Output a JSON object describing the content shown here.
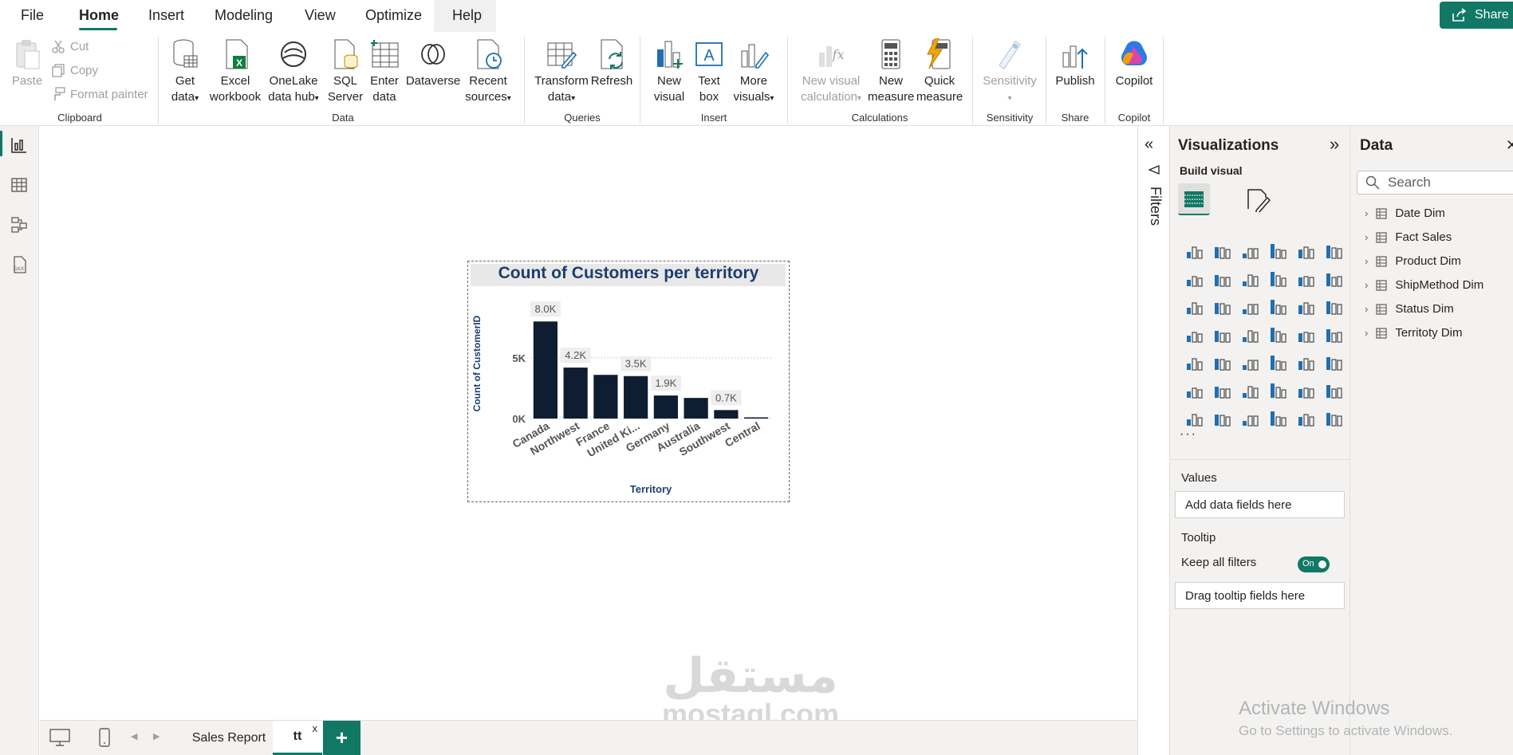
{
  "menu": {
    "items": [
      "File",
      "Home",
      "Insert",
      "Modeling",
      "View",
      "Optimize",
      "Help"
    ],
    "share_label": "Share"
  },
  "ribbon": {
    "clipboard": {
      "paste": "Paste",
      "cut": "Cut",
      "copy": "Copy",
      "format_painter": "Format painter",
      "group": "Clipboard"
    },
    "data": {
      "get_data": [
        "Get",
        "data"
      ],
      "excel": [
        "Excel",
        "workbook"
      ],
      "onelake": [
        "OneLake",
        "data hub"
      ],
      "sql": [
        "SQL",
        "Server"
      ],
      "enter": [
        "Enter",
        "data"
      ],
      "dataverse": "Dataverse",
      "recent": [
        "Recent",
        "sources"
      ],
      "group": "Data"
    },
    "queries": {
      "transform": [
        "Transform",
        "data"
      ],
      "refresh": "Refresh",
      "group": "Queries"
    },
    "insert": {
      "new_visual": [
        "New",
        "visual"
      ],
      "text_box": [
        "Text",
        "box"
      ],
      "more_visuals": [
        "More",
        "visuals"
      ],
      "group": "Insert"
    },
    "calculations": {
      "new_visual_calc": [
        "New visual",
        "calculation"
      ],
      "new_measure": [
        "New",
        "measure"
      ],
      "quick_measure": [
        "Quick",
        "measure"
      ],
      "group": "Calculations"
    },
    "sensitivity": {
      "label": "Sensitivity",
      "group": "Sensitivity"
    },
    "share": {
      "publish": "Publish",
      "group": "Share"
    },
    "copilot": {
      "label": "Copilot",
      "group": "Copilot"
    }
  },
  "visual": {
    "title": "Count of Customers per territory"
  },
  "chart_data": {
    "type": "bar",
    "title": "Count of Customers per territory",
    "xlabel": "Territory",
    "ylabel": "Count of CustomerID",
    "categories": [
      "Canada",
      "Northwest",
      "France",
      "United Ki...",
      "Germany",
      "Australia",
      "Southwest",
      "Central"
    ],
    "values": [
      8000,
      4200,
      3600,
      3500,
      1900,
      1700,
      700,
      100
    ],
    "data_labels": [
      "8.0K",
      "4.2K",
      "",
      "3.5K",
      "1.9K",
      "",
      "0.7K",
      ""
    ],
    "yticks": [
      "0K",
      "5K"
    ],
    "ylim": [
      0,
      9000
    ],
    "bar_color": "#0f1d33",
    "grid": true
  },
  "bottom": {
    "tabs": [
      "Sales Report",
      "tt"
    ],
    "close_mark": "x",
    "add": "+"
  },
  "filters": {
    "label": "Filters"
  },
  "visualizations": {
    "title": "Visualizations",
    "build_visual": "Build visual",
    "values_label": "Values",
    "values_placeholder": "Add data fields here",
    "tooltip_label": "Tooltip",
    "keep_filters": "Keep all filters",
    "toggle": "On",
    "tooltip_placeholder": "Drag tooltip fields here",
    "more": "···"
  },
  "data_pane": {
    "title": "Data",
    "search_placeholder": "Search",
    "tables": [
      "Date Dim",
      "Fact Sales",
      "Product Dim",
      "ShipMethod Dim",
      "Status Dim",
      "Territoty Dim"
    ]
  },
  "watermark": {
    "arabic": "مستقل",
    "latin": "mostaql.com"
  },
  "activate": {
    "line1": "Activate Windows",
    "line2": "Go to Settings to activate Windows."
  },
  "colors": {
    "accent": "#117865",
    "title": "#1d3e6e",
    "bar": "#0f1d33"
  }
}
